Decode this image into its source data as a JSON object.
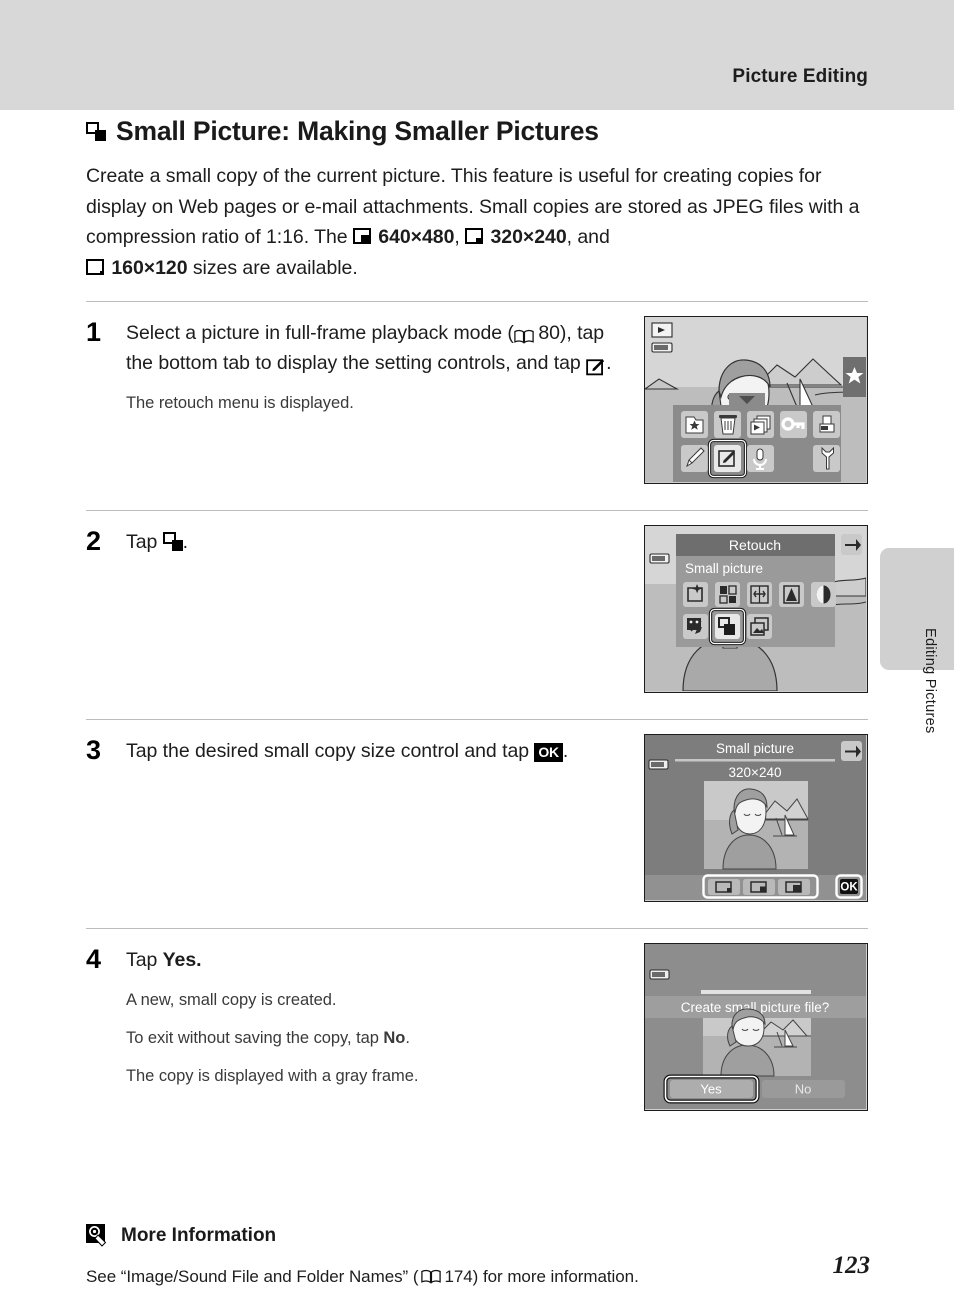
{
  "header": {
    "running_head": "Picture Editing"
  },
  "side_tab": {
    "label": "Editing Pictures"
  },
  "page_number": "123",
  "section": {
    "title": "Small Picture: Making Smaller Pictures",
    "title_icon": "small-picture-icon",
    "intro_part1": "Create a small copy of the current picture. This feature is useful for creating copies for display on Web pages or e-mail attachments. Small copies are stored as JPEG files with a compression ratio of 1:16. The ",
    "size_640": "640×480",
    "intro_sep1": ", ",
    "size_320": "320×240",
    "intro_sep2": ", and ",
    "size_160": "160×120",
    "intro_part2": " sizes are available."
  },
  "steps": [
    {
      "number": "1",
      "lead_a": "Select a picture in full-frame playback mode (",
      "page_ref": "80",
      "lead_b": "), tap the bottom tab to display the setting controls, and tap ",
      "lead_c": ".",
      "notes": [
        "The retouch menu is displayed."
      ],
      "screen": {
        "name": "playback-control-panel-screen",
        "icons_row1": [
          "favorites-icon",
          "delete-icon",
          "slide-show-icon",
          "protect-icon",
          "print-order-icon"
        ],
        "icons_row2": [
          "paint-icon",
          "retouch-icon",
          "voice-memo-icon",
          "setup-icon"
        ],
        "selected_icon": "retouch-icon",
        "badges": [
          "playback-mode-icon",
          "battery-icon",
          "favorites-tab-icon"
        ]
      }
    },
    {
      "number": "2",
      "lead_a": "Tap ",
      "lead_c": ".",
      "notes": [],
      "screen": {
        "name": "retouch-menu-screen",
        "title": "Retouch",
        "selected_label": "Small picture",
        "icons_row1": [
          "quick-retouch-icon",
          "d-lighting-icon",
          "skin-softening-icon",
          "filter-effects-icon",
          "color-options-icon"
        ],
        "icons_row2": [
          "glamour-retouch-icon",
          "small-picture-icon",
          "copy-icon"
        ],
        "selected_icon": "small-picture-icon",
        "back_button": "back-icon"
      }
    },
    {
      "number": "3",
      "lead_a": "Tap the desired small copy size control and tap ",
      "lead_c": ".",
      "notes": [],
      "screen": {
        "name": "small-picture-size-screen",
        "title": "Small picture",
        "size_value": "320×240",
        "size_buttons": [
          "size-160x120-button",
          "size-320x240-button",
          "size-640x480-button"
        ],
        "confirm_button": "OK",
        "back_button": "back-icon"
      }
    },
    {
      "number": "4",
      "lead_a": "Tap ",
      "lead_bold": "Yes",
      "lead_c": ".",
      "notes_rich": [
        {
          "a": "A new, small copy is created.",
          "b": "",
          "c": ""
        },
        {
          "a": "To exit without saving the copy, tap ",
          "b": "No",
          "c": "."
        },
        {
          "a": "The copy is displayed with a gray frame.",
          "b": "",
          "c": ""
        }
      ],
      "screen": {
        "name": "create-small-picture-confirm-screen",
        "prompt": "Create small picture file?",
        "yes_label": "Yes",
        "no_label": "No",
        "selected_button": "Yes"
      }
    }
  ],
  "more_information": {
    "icon": "more-information-icon",
    "heading": "More Information",
    "text_a": "See “Image/Sound File and Folder Names” (",
    "page_ref": "174",
    "text_b": ") for more information."
  },
  "colors": {
    "header_band": "#d8d8d8",
    "side_tab": "#d0d0d0",
    "rule": "#bcbcbc",
    "screen_bg": "#cfcfcf",
    "screen_panel": "#8b8b8b",
    "screen_panel_dark": "#6f6f6f",
    "text": "#1d1d1d"
  }
}
